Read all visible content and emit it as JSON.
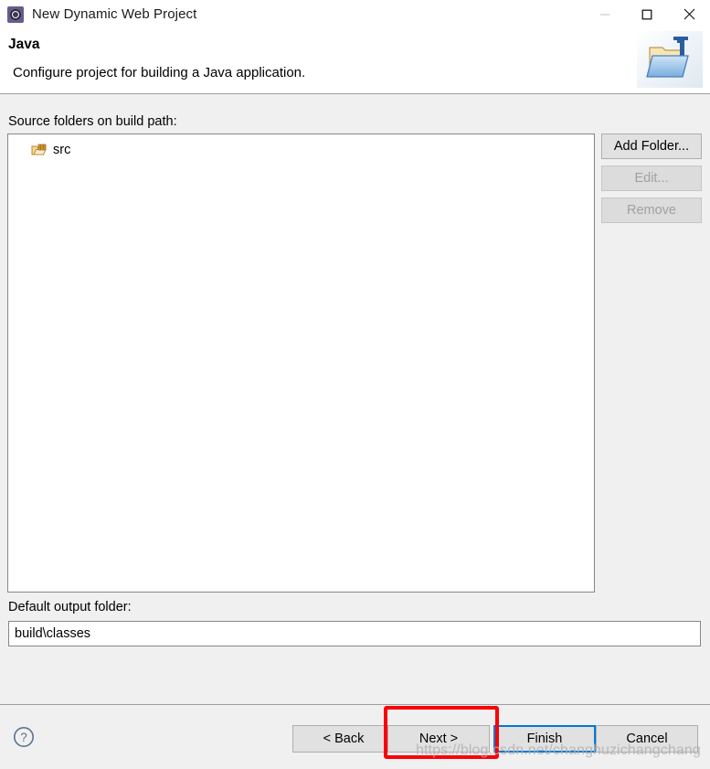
{
  "window": {
    "title": "New Dynamic Web Project",
    "icon": "eclipse-wizard-icon",
    "controls": {
      "minimize": "minimize-icon",
      "maximize": "maximize-icon",
      "close": "close-icon"
    }
  },
  "header": {
    "title": "Java",
    "description": "Configure project for building a Java application.",
    "banner_icon": "java-folder-icon"
  },
  "main": {
    "source_folders_label": "Source folders on build path:",
    "source_folders": [
      {
        "name": "src",
        "icon": "package-folder-icon"
      }
    ],
    "side_buttons": [
      {
        "label": "Add Folder...",
        "enabled": true
      },
      {
        "label": "Edit...",
        "enabled": false
      },
      {
        "label": "Remove",
        "enabled": false
      }
    ],
    "output_folder_label": "Default output folder:",
    "output_folder_value": "build\\classes"
  },
  "footer": {
    "help_icon": "help-question-icon",
    "buttons": {
      "back": "< Back",
      "next": "Next >",
      "finish": "Finish",
      "cancel": "Cancel"
    }
  },
  "annotation": {
    "highlight_target": "Next >",
    "highlight_color": "#fb0007"
  },
  "watermark": {
    "text": "https://blog.csdn.net/changhuzichangchang"
  }
}
